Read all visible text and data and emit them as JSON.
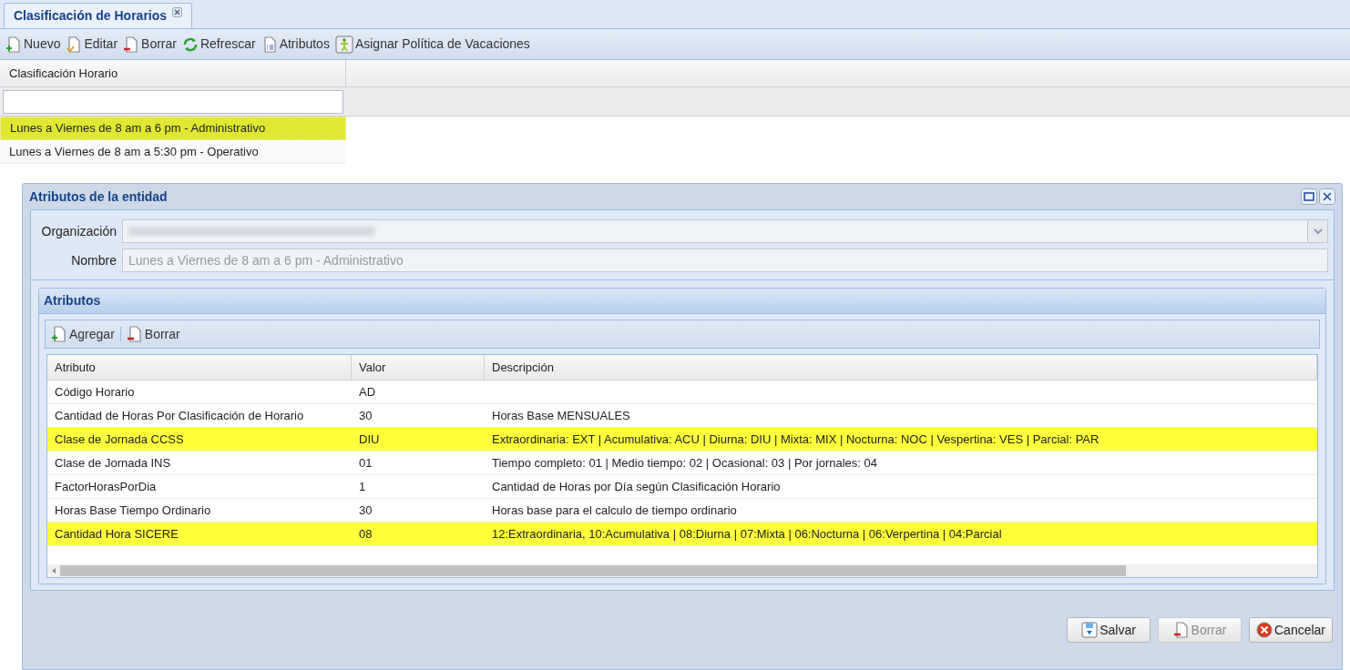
{
  "tab": {
    "title": "Clasificación de Horarios"
  },
  "toolbar": [
    {
      "label": "Nuevo",
      "kind": "new"
    },
    {
      "label": "Editar",
      "kind": "edit"
    },
    {
      "label": "Borrar",
      "kind": "delete"
    },
    {
      "label": "Refrescar",
      "kind": "refresh"
    },
    {
      "label": "Atributos",
      "kind": "list"
    },
    {
      "label": "Asignar Política de Vacaciones",
      "kind": "person"
    }
  ],
  "list": {
    "column": "Clasificación Horario",
    "rows": [
      {
        "text": "Lunes a Viernes de 8 am a 6 pm - Administrativo",
        "selected": true
      },
      {
        "text": "Lunes a Viernes de 8 am a 5:30 pm - Operativo",
        "selected": false
      }
    ]
  },
  "dialog": {
    "title": "Atributos de la entidad",
    "fields": [
      {
        "label": "Organización",
        "kind": "combo"
      },
      {
        "label": "Nombre",
        "kind": "text",
        "value": "Lunes a Viernes de 8 am a 6 pm - Administrativo"
      }
    ],
    "panel": {
      "title": "Atributos",
      "toolbar": [
        {
          "label": "Agregar",
          "kind": "new"
        },
        {
          "label": "Borrar",
          "kind": "delete"
        }
      ],
      "columns": [
        "Atributo",
        "Valor",
        "Descripción"
      ],
      "rows": [
        {
          "cells": [
            "Código Horario",
            "AD",
            ""
          ],
          "highlighted": false
        },
        {
          "cells": [
            "Cantidad de Horas Por Clasificación de Horario",
            "30",
            "Horas Base MENSUALES"
          ],
          "highlighted": false
        },
        {
          "cells": [
            "Clase de Jornada CCSS",
            "DIU",
            "Extraordinaria: EXT | Acumulativa: ACU | Diurna: DIU | Mixta: MIX | Nocturna: NOC | Vespertina: VES | Parcial: PAR"
          ],
          "highlighted": true
        },
        {
          "cells": [
            "Clase de Jornada INS",
            "01",
            "Tiempo completo: 01 | Medio tiempo: 02 | Ocasional: 03 | Por jornales: 04"
          ],
          "highlighted": false
        },
        {
          "cells": [
            "FactorHorasPorDia",
            "1",
            "Cantidad de Horas por Día según Clasificación Horario"
          ],
          "highlighted": false
        },
        {
          "cells": [
            "Horas Base Tiempo Ordinario",
            "30",
            "Horas base para el calculo de tiempo ordinario"
          ],
          "highlighted": false
        },
        {
          "cells": [
            "Cantidad Hora SICERE",
            "08",
            "12:Extraordinaria, 10:Acumulativa | 08:Diurna | 07:Mixta | 06:Nocturna | 06:Verpertina | 04:Parcial"
          ],
          "highlighted": true
        }
      ]
    },
    "buttons": [
      {
        "label": "Salvar",
        "kind": "save",
        "disabled": false
      },
      {
        "label": "Borrar",
        "kind": "delete",
        "disabled": true
      },
      {
        "label": "Cancelar",
        "kind": "cancel",
        "disabled": false
      }
    ]
  }
}
